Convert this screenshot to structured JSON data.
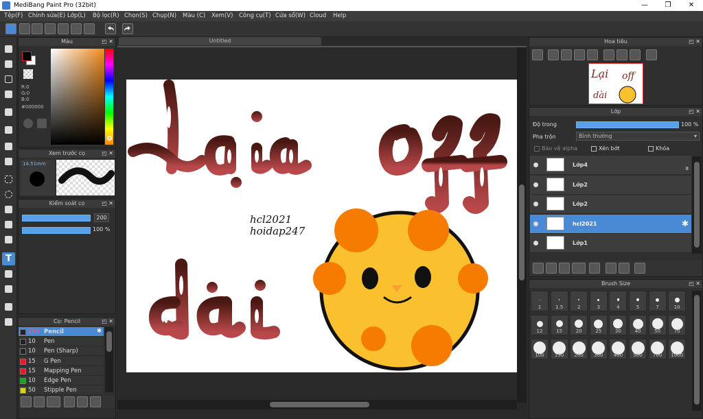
{
  "window": {
    "title": "MediBang Paint Pro (32bit)",
    "minimize": "—",
    "restore": "❐",
    "close": "✕"
  },
  "menu": [
    "Tệp(F)",
    "Chỉnh sửa(E)",
    "Lớp(L)",
    "Bộ lọc(R)",
    "Chọn(S)",
    "Chụp(N)",
    "Màu (C)",
    "Xem(V)",
    "Công cụ(T)",
    "Cửa sổ(W)",
    "Cloud",
    "Help"
  ],
  "color_panel": {
    "title": "Màu",
    "r": "R:0",
    "g": "G:0",
    "b": "B:0",
    "hex": "#000000"
  },
  "brush_preview": {
    "title": "Xem trước cọ",
    "size": "14.51mm"
  },
  "brush_control": {
    "title": "Kiểm soát cọ",
    "size_value": "200",
    "opacity_value": "100 %"
  },
  "pen_panel": {
    "title": "Cọ: Pencil",
    "items": [
      {
        "size": "200",
        "name": "Pencil",
        "color": "#222222",
        "selected": true
      },
      {
        "size": "10",
        "name": "Pen",
        "color": "#222222"
      },
      {
        "size": "10",
        "name": "Pen (Sharp)",
        "color": "#222222"
      },
      {
        "size": "15",
        "name": "G Pen",
        "color": "#e02020"
      },
      {
        "size": "15",
        "name": "Mapping Pen",
        "color": "#e02020"
      },
      {
        "size": "10",
        "name": "Edge Pen",
        "color": "#20a020"
      },
      {
        "size": "50",
        "name": "Stipple Pen",
        "color": "#e0d020"
      }
    ]
  },
  "document": {
    "tab": "Untitled"
  },
  "canvas_text": {
    "line1": "hcl2021",
    "line2": "hoidap247"
  },
  "navigator": {
    "title": "Hoa tiêu"
  },
  "layer_panel": {
    "title": "Lớp",
    "opacity_label": "Độ trong",
    "opacity_value": "100 %",
    "blend_label": "Pha trộn",
    "blend_value": "Bình thường",
    "protect_alpha": "Bảo vệ alpha",
    "clipping": "Xén bớt",
    "lock": "Khóa",
    "layers": [
      {
        "name": "Lớp4",
        "selected": false,
        "badge": "8"
      },
      {
        "name": "Lớp2",
        "selected": false
      },
      {
        "name": "Lớp2",
        "selected": false
      },
      {
        "name": "hcl2021",
        "selected": true
      },
      {
        "name": "Lớp1",
        "selected": false
      }
    ]
  },
  "brush_size_panel": {
    "title": "Brush Size",
    "sizes": [
      "1",
      "1.5",
      "2",
      "3",
      "4",
      "5",
      "7",
      "10",
      "12",
      "15",
      "20",
      "25",
      "30",
      "40",
      "50",
      "70",
      "100",
      "150",
      "200",
      "300",
      "400",
      "500",
      "700",
      "1000"
    ]
  },
  "colors": {
    "accent": "#4a8ad4",
    "panel": "#2f2f2f",
    "lettering": "#8b2a2a",
    "sun": "#fbc02d",
    "sun_spots": "#f57c00"
  }
}
